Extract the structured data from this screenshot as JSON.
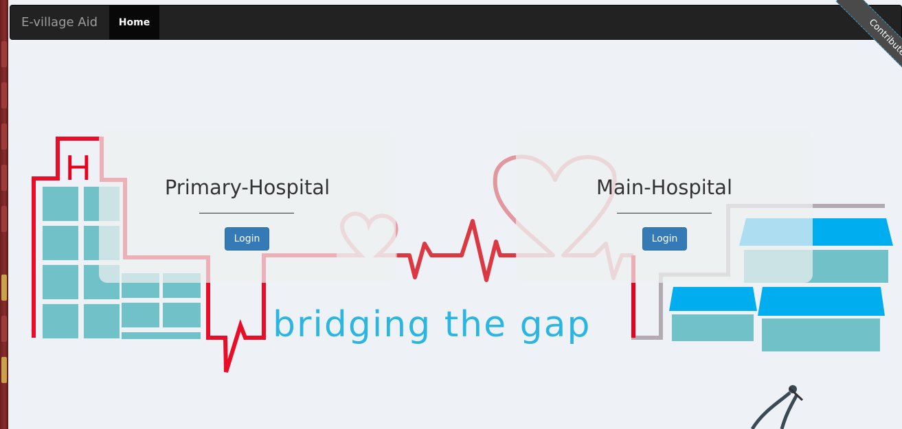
{
  "navbar": {
    "brand": "E-village Aid",
    "home_label": "Home"
  },
  "ribbon": {
    "label": "Contribute"
  },
  "hero": {
    "tagline": "bridging the gap",
    "hospital_sign": "H"
  },
  "panels": [
    {
      "title": "Primary-Hospital",
      "button": "Login"
    },
    {
      "title": "Main-Hospital",
      "button": "Login"
    }
  ],
  "colors": {
    "navbar_bg": "#222222",
    "button": "#337ab7",
    "ecg_red": "#e8001c",
    "teal": "#70c1c8",
    "blue": "#00aeef",
    "tagline": "#2bb5e0"
  },
  "icons": [
    "hospital-building-icon",
    "heart-icon",
    "clinic-buildings-icon",
    "stethoscope-icon"
  ]
}
